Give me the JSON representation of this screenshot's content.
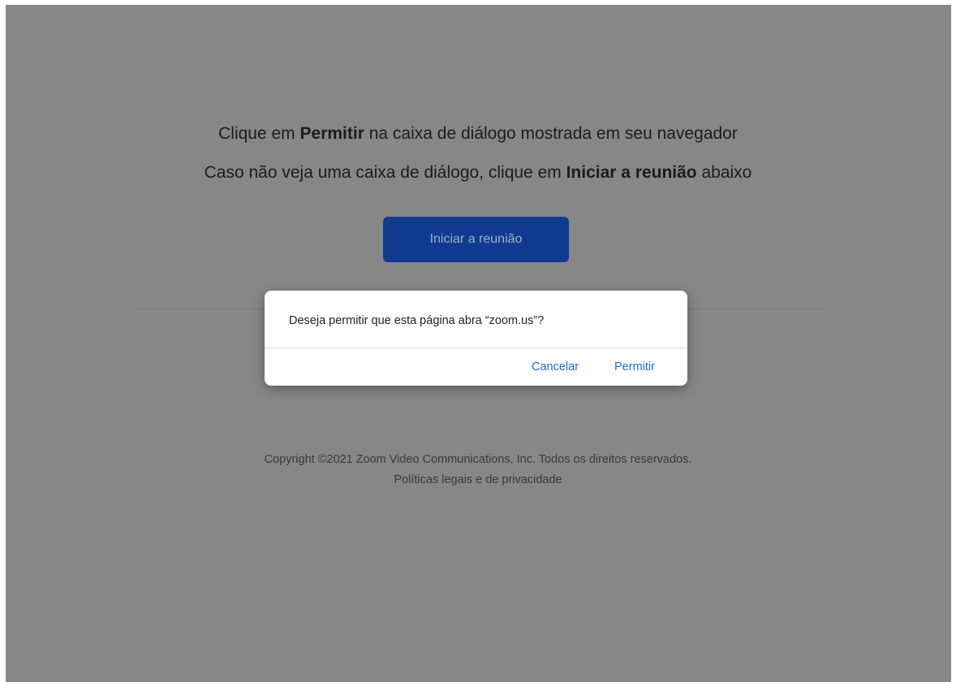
{
  "instructions": {
    "line1_pre": "Clique em ",
    "line1_bold": "Permitir",
    "line1_post": " na caixa de diálogo mostrada em seu navegador",
    "line2_pre": "Caso não veja uma caixa de diálogo, clique em ",
    "line2_bold": "Iniciar a reunião",
    "line2_post": " abaixo"
  },
  "launch_button": {
    "label": "Iniciar a reunião"
  },
  "dialog": {
    "message": "Deseja permitir que esta página abra “zoom.us”?",
    "cancel_label": "Cancelar",
    "allow_label": "Permitir"
  },
  "footer": {
    "copyright": "Copyright ©2021 Zoom Video Communications, Inc. Todos os direitos reservados.",
    "legal_link": "Políticas legais e de privacidade"
  },
  "colors": {
    "overlay_background": "#878787",
    "launch_button": "#0e3a8f",
    "dialog_button_text": "#1a6ee6"
  }
}
